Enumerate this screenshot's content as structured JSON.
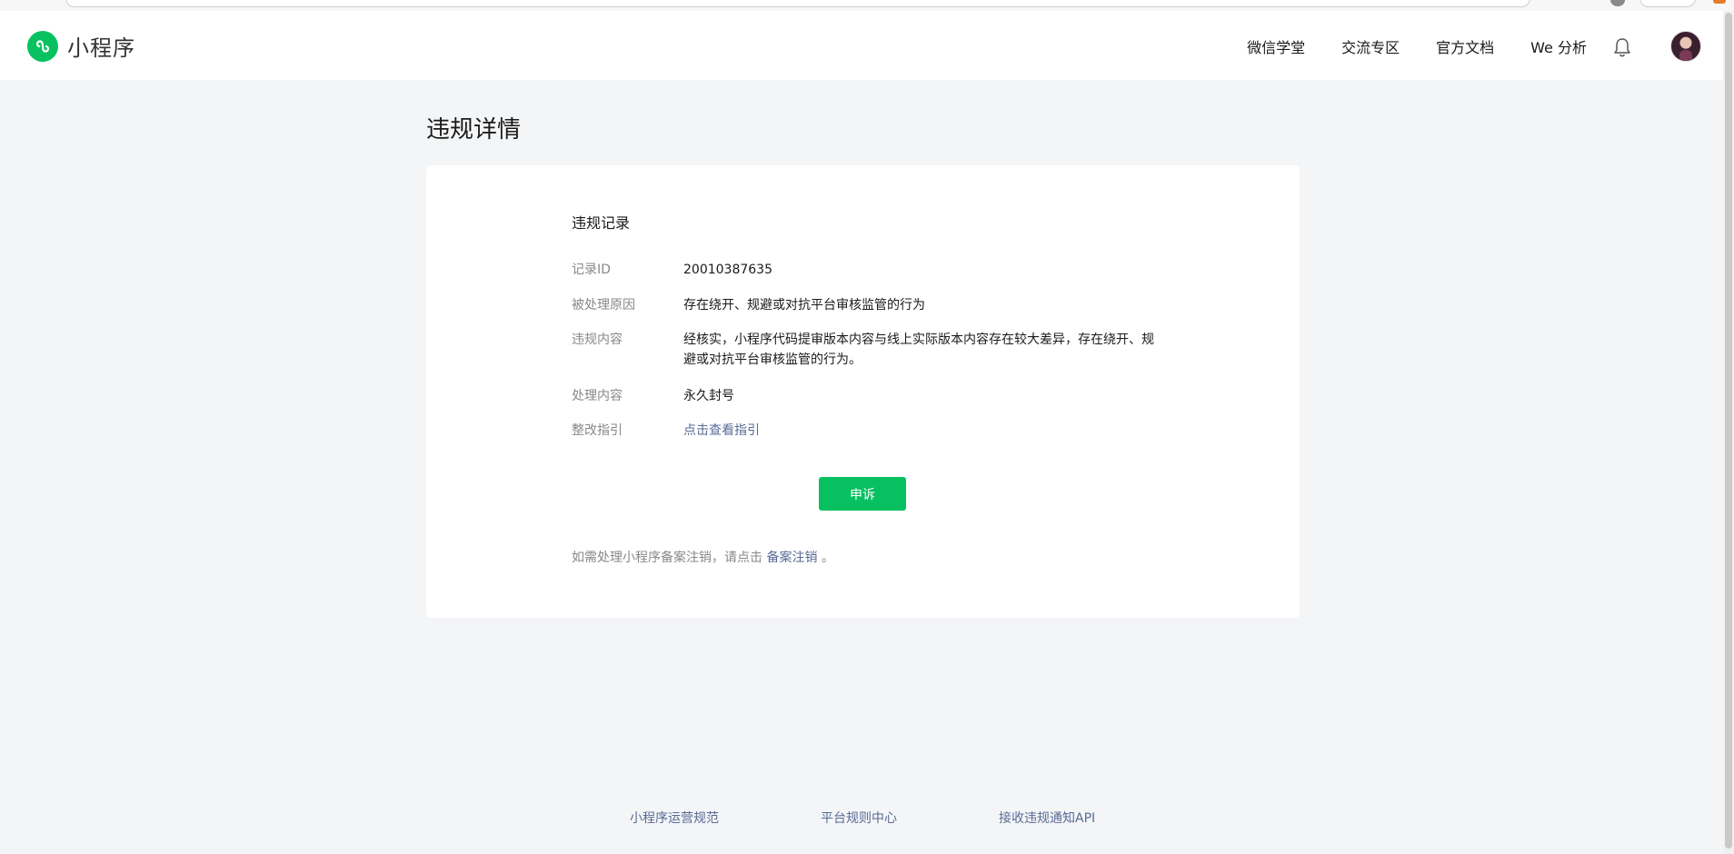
{
  "header": {
    "app_name": "小程序",
    "nav": [
      {
        "label": "微信学堂"
      },
      {
        "label": "交流专区"
      },
      {
        "label": "官方文档"
      },
      {
        "label": "We 分析"
      }
    ]
  },
  "page": {
    "title": "违规详情"
  },
  "record": {
    "section_title": "违规记录",
    "rows": [
      {
        "label": "记录ID",
        "value": "20010387635"
      },
      {
        "label": "被处理原因",
        "value": "存在绕开、规避或对抗平台审核监管的行为"
      },
      {
        "label": "违规内容",
        "value": "经核实，小程序代码提审版本内容与线上实际版本内容存在较大差异，存在绕开、规避或对抗平台审核监管的行为。"
      },
      {
        "label": "处理内容",
        "value": "永久封号"
      },
      {
        "label": "整改指引",
        "value": "点击查看指引"
      }
    ],
    "appeal_button": "申诉",
    "note_prefix": "如需处理小程序备案注销，请点击",
    "note_link": "备案注销",
    "note_suffix": "。"
  },
  "footer": {
    "links": [
      {
        "label": "小程序运营规范"
      },
      {
        "label": "平台规则中心"
      },
      {
        "label": "接收违规通知API"
      }
    ]
  },
  "colors": {
    "brand_green": "#07c160",
    "link_blue": "#576b95",
    "label_gray": "#888888",
    "page_bg": "#f4f5f7"
  }
}
